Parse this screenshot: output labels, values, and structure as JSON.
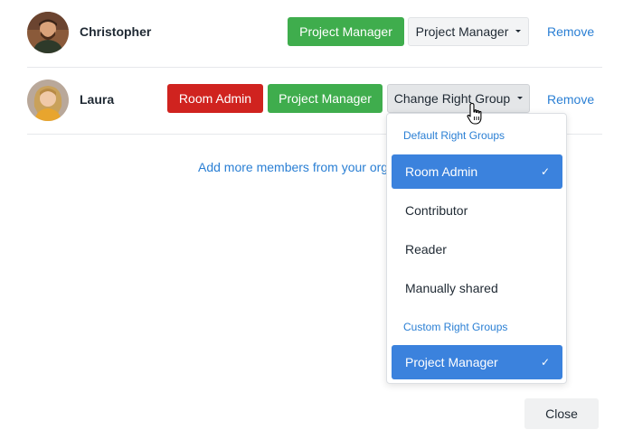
{
  "members": [
    {
      "name": "Christopher",
      "roles": [
        "Project Manager"
      ],
      "selector_label": "Project Manager",
      "remove_label": "Remove"
    },
    {
      "name": "Laura",
      "roles": [
        "Room Admin",
        "Project Manager"
      ],
      "selector_label": "Change Right Group",
      "remove_label": "Remove"
    }
  ],
  "add_more_label": "Add more members from your orga",
  "dropdown": {
    "default_header": "Default Right Groups",
    "default_items": [
      {
        "label": "Room Admin",
        "selected": true
      },
      {
        "label": "Contributor",
        "selected": false
      },
      {
        "label": "Reader",
        "selected": false
      },
      {
        "label": "Manually shared",
        "selected": false
      }
    ],
    "custom_header": "Custom Right Groups",
    "custom_items": [
      {
        "label": "Project Manager",
        "selected": true
      }
    ],
    "check_icon": "✓"
  },
  "close_label": "Close",
  "colors": {
    "green": "#3fad4d",
    "red": "#d0231f",
    "link_blue": "#2a7fd4",
    "selected_blue": "#3b82dd"
  },
  "icons": {
    "cursor": "hand-pointer-icon",
    "check": "checkmark-icon",
    "caret": "caret-down-icon"
  }
}
